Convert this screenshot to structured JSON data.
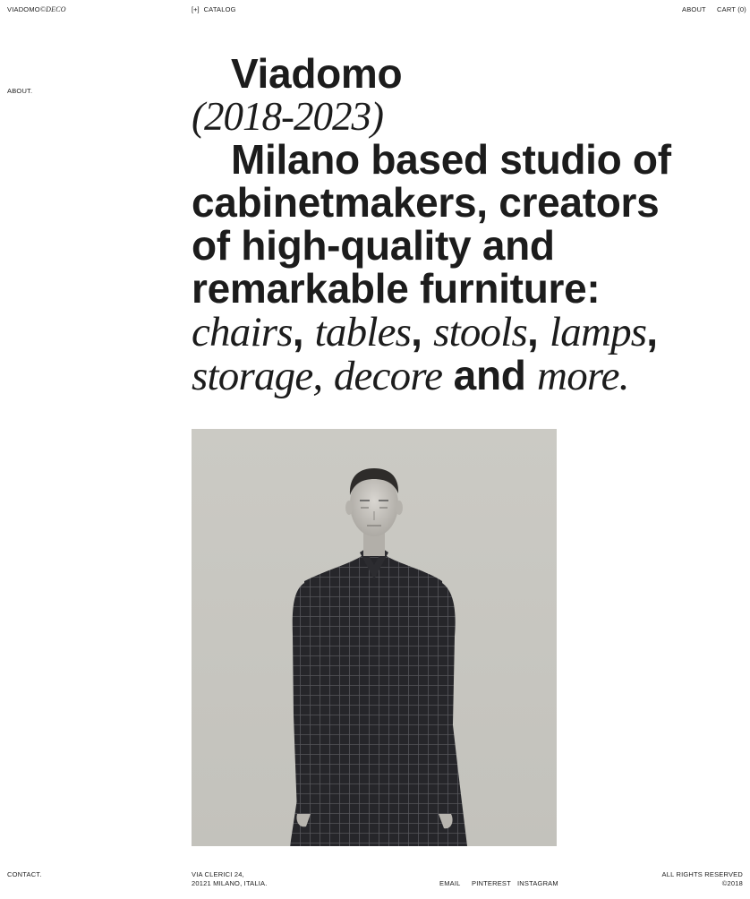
{
  "header": {
    "logo_main": "VIADOMO",
    "logo_suffix": "©DECO",
    "catalog_icon": "[+]",
    "catalog_label": "CATALOG",
    "about_label": "ABOUT",
    "cart_label": "CART (0)"
  },
  "sidebar": {
    "about_label": "ABOUT.",
    "contact_label": "CONTACT."
  },
  "hero": {
    "name": "Viadomo",
    "years": "(2018-2023)",
    "line1": "Milano based studio of",
    "line2": "cabinetmakers, creators",
    "line3": "of high-quality and",
    "line4": "remarkable furniture:",
    "items": [
      "chairs",
      "tables",
      "stools",
      "lamps",
      "storage",
      "decore"
    ],
    "and_word": "and",
    "more_word": "more."
  },
  "photo": {
    "icon": "portrait-photo"
  },
  "footer": {
    "address_line1": "VIA CLERICI 24,",
    "address_line2": "20121 MILANO, ITALIA.",
    "links": [
      "EMAIL",
      "PINTEREST",
      "INSTAGRAM"
    ],
    "rights": "ALL RIGHTS RESERVED",
    "copyright": "©2018"
  }
}
